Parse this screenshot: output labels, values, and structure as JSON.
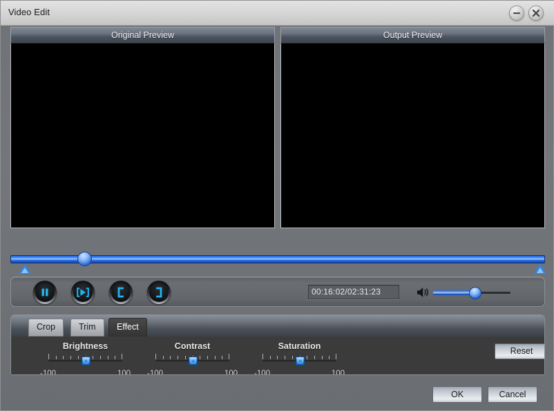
{
  "window": {
    "title": "Video Edit",
    "minimize_icon": "minimize-icon",
    "close_icon": "close-icon"
  },
  "previews": {
    "original": {
      "header": "Original Preview"
    },
    "output": {
      "header": "Output Preview"
    }
  },
  "timeline": {
    "position_percent": 13,
    "in_marker_percent": 2,
    "out_marker_percent": 98
  },
  "transport": {
    "buttons": [
      {
        "name": "pause-button",
        "icon": "pause-icon"
      },
      {
        "name": "play-selection-button",
        "icon": "play-in-brackets-icon"
      },
      {
        "name": "set-in-point-button",
        "icon": "bracket-left-icon"
      },
      {
        "name": "set-out-point-button",
        "icon": "bracket-right-icon"
      }
    ],
    "time_display": "00:16:02/02:31:23",
    "volume_icon": "speaker-icon",
    "volume_percent": 52
  },
  "tabs": [
    {
      "label": "Crop",
      "active": false
    },
    {
      "label": "Trim",
      "active": false
    },
    {
      "label": "Effect",
      "active": true
    }
  ],
  "effects": {
    "sliders": [
      {
        "label": "Brightness",
        "min_label": "-100",
        "max_label": "100",
        "value": 0
      },
      {
        "label": "Contrast",
        "min_label": "-100",
        "max_label": "100",
        "value": 0
      },
      {
        "label": "Saturation",
        "min_label": "-100",
        "max_label": "100",
        "value": 0
      }
    ],
    "reset_label": "Reset"
  },
  "footer": {
    "ok_label": "OK",
    "cancel_label": "Cancel"
  },
  "colors": {
    "accent_blue": "#2f6fd8",
    "glyph_cyan": "#23b4ef",
    "window_gray": "#6f7276",
    "panel_dark": "#3b3b3b"
  }
}
